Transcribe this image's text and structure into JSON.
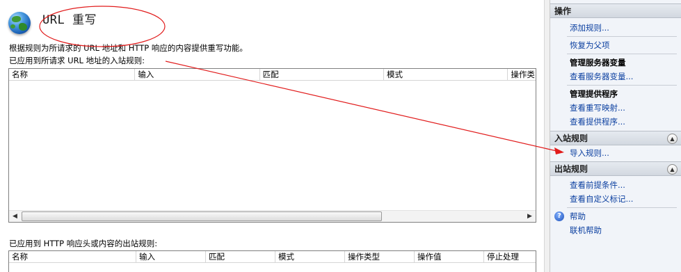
{
  "feature": {
    "title": "URL 重写",
    "description": "根据规则为所请求的 URL 地址和 HTTP 响应的内容提供重写功能。"
  },
  "inbound": {
    "label": "已应用到所请求 URL 地址的入站规则:",
    "columns": [
      "名称",
      "输入",
      "匹配",
      "模式",
      "操作类"
    ]
  },
  "outbound": {
    "label": "已应用到 HTTP 响应头或内容的出站规则:",
    "columns": [
      "名称",
      "输入",
      "匹配",
      "模式",
      "操作类型",
      "操作值",
      "停止处理"
    ]
  },
  "actions": {
    "header": "操作",
    "add_rule": "添加规则...",
    "revert_parent": "恢复为父项",
    "server_vars_title": "管理服务器变量",
    "view_server_vars": "查看服务器变量...",
    "providers_title": "管理提供程序",
    "view_rewrite_maps": "查看重写映射...",
    "view_providers": "查看提供程序...",
    "inbound_header": "入站规则",
    "import_rules": "导入规则...",
    "outbound_header": "出站规则",
    "view_preconditions": "查看前提条件...",
    "view_custom_tags": "查看自定义标记...",
    "help": "帮助",
    "online_help": "联机帮助"
  },
  "icons": {
    "feature": "globe-icon",
    "help": "help-icon",
    "collapse": "chevron-up-icon"
  },
  "colors": {
    "link": "#0b3fa0",
    "annotation": "#e11b1b",
    "pane_bg": "#f1f4f9"
  }
}
